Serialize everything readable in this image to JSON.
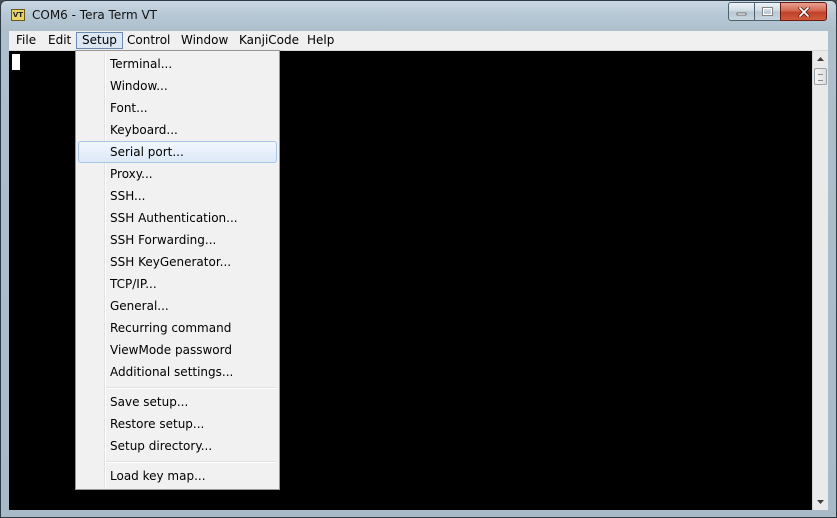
{
  "window": {
    "title": "COM6 - Tera Term VT",
    "icon_label": "VT",
    "icon": "tera-term-icon"
  },
  "menubar": {
    "items": [
      {
        "label": "File"
      },
      {
        "label": "Edit"
      },
      {
        "label": "Setup",
        "active": true
      },
      {
        "label": "Control"
      },
      {
        "label": "Window"
      },
      {
        "label": "KanjiCode"
      },
      {
        "label": "Help"
      }
    ]
  },
  "setup_menu": {
    "items": [
      {
        "label": "Terminal..."
      },
      {
        "label": "Window..."
      },
      {
        "label": "Font..."
      },
      {
        "label": "Keyboard..."
      },
      {
        "label": "Serial port...",
        "highlighted": true
      },
      {
        "label": "Proxy..."
      },
      {
        "label": "SSH..."
      },
      {
        "label": "SSH Authentication..."
      },
      {
        "label": "SSH Forwarding..."
      },
      {
        "label": "SSH KeyGenerator..."
      },
      {
        "label": "TCP/IP..."
      },
      {
        "label": "General..."
      },
      {
        "label": "Recurring command"
      },
      {
        "label": "ViewMode password"
      },
      {
        "label": "Additional settings..."
      },
      {
        "label": "Save setup..."
      },
      {
        "label": "Restore setup..."
      },
      {
        "label": "Setup directory..."
      },
      {
        "label": "Load key map..."
      }
    ]
  },
  "terminal": {
    "background": "#000000",
    "cursor_color": "#ffffff"
  },
  "colors": {
    "menu_highlight": "#dce9f8",
    "close_button": "#c0412a"
  }
}
